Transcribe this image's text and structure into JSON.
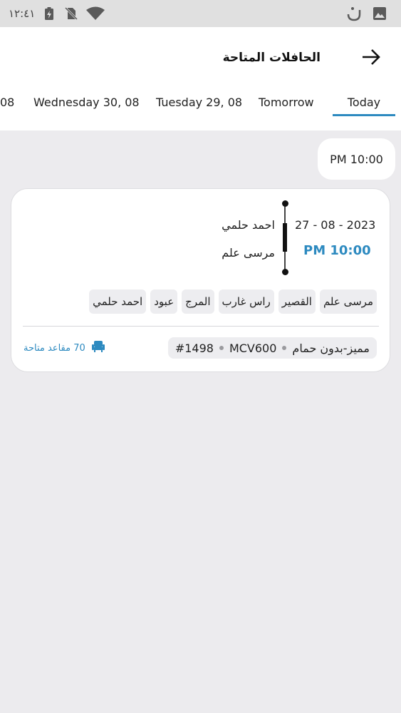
{
  "status_bar": {
    "time": "١٢:٤١",
    "icons": [
      "battery-charging-icon",
      "no-sim-icon",
      "wifi-icon",
      "notification-icon",
      "image-icon"
    ]
  },
  "header": {
    "title": "الحافلات المتاحة",
    "back_icon": "arrow-right-icon"
  },
  "tabs": [
    {
      "label": "08",
      "active": false
    },
    {
      "label": "Wednesday 30, 08",
      "active": false
    },
    {
      "label": "Tuesday 29, 08",
      "active": false
    },
    {
      "label": "Tomorrow",
      "active": false
    },
    {
      "label": "Today",
      "active": true
    }
  ],
  "time_filter": "PM 10:00",
  "trip": {
    "date": "27 - 08 - 2023",
    "departure_time": "PM 10:00",
    "from": "احمد حلمي",
    "to": "مرسى علم",
    "stops": [
      "مرسى علم",
      "القصير",
      "راس غارب",
      "المرج",
      "عبود",
      "احمد حلمي"
    ],
    "bus_type": "مميز-بدون حمام",
    "bus_model": "MCV600",
    "bus_number": "#1498",
    "seats_available": "70 مقاعد متاحة"
  },
  "colors": {
    "accent": "#2d8ac0",
    "background": "#ecebee",
    "card": "#ffffff",
    "chip": "#ededf0"
  }
}
